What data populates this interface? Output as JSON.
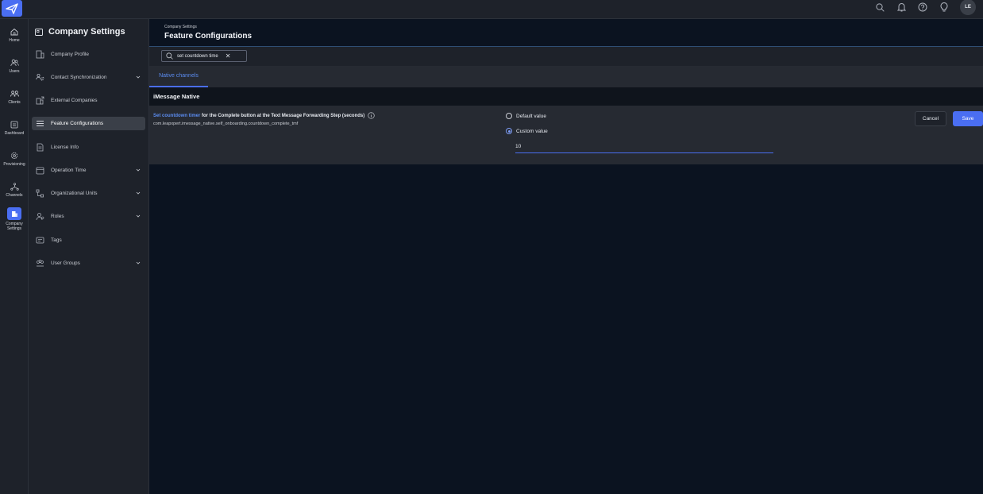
{
  "topbar": {
    "avatar_initials": "LE",
    "icons": [
      "search-icon",
      "bell-icon",
      "help-icon",
      "lightbulb-icon"
    ]
  },
  "rail": {
    "items": [
      {
        "label": "Home",
        "icon": "home-icon"
      },
      {
        "label": "Users",
        "icon": "users-icon"
      },
      {
        "label": "Clients",
        "icon": "clients-icon"
      },
      {
        "label": "Dashboard",
        "icon": "dashboard-icon"
      },
      {
        "label": "Provisioning",
        "icon": "gear-icon"
      },
      {
        "label": "Channels",
        "icon": "channels-icon"
      },
      {
        "label": "Company Settings",
        "icon": "company-settings-icon",
        "active": true
      }
    ]
  },
  "sidemenu": {
    "title": "Company Settings",
    "items": [
      {
        "label": "Company Profile",
        "chevron": false
      },
      {
        "label": "Contact Synchronization",
        "chevron": true
      },
      {
        "label": "External Companies",
        "chevron": false
      },
      {
        "label": "Feature Configurations",
        "chevron": false,
        "active": true
      },
      {
        "label": "License Info",
        "chevron": false
      },
      {
        "label": "Operation Time",
        "chevron": true
      },
      {
        "label": "Organizational Units",
        "chevron": true
      },
      {
        "label": "Roles",
        "chevron": true
      },
      {
        "label": "Tags",
        "chevron": false
      },
      {
        "label": "User Groups",
        "chevron": true
      }
    ]
  },
  "header": {
    "breadcrumb": "Company Settings",
    "title": "Feature Configurations"
  },
  "search": {
    "value": "set countdown time"
  },
  "tabs": [
    {
      "label": "Native channels",
      "active": true
    }
  ],
  "section": {
    "title": "iMessage Native"
  },
  "config": {
    "title_highlight": "Set countdown timer",
    "title_rest": " for the Complete button at the Text Message Forwarding Step (seconds)",
    "key": "com.leapxpert.imessage_native.self_onboarding.countdown_complete_tmf",
    "default_label": "Default value",
    "custom_label": "Custom value",
    "selected": "custom",
    "value": "10",
    "cancel_label": "Cancel",
    "save_label": "Save"
  },
  "colors": {
    "accent": "#4a6ef2",
    "highlight_text": "#5b8cf0",
    "background": "#0b1320",
    "panel": "#1e222a"
  }
}
